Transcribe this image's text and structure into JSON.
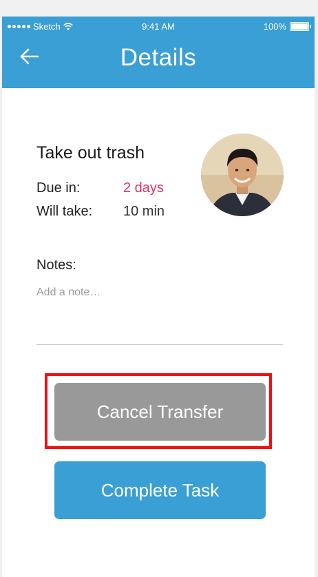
{
  "status_bar": {
    "carrier": "Sketch",
    "time": "9:41 AM",
    "battery": "100%"
  },
  "header": {
    "title": "Details",
    "back_icon": "arrow-left-icon"
  },
  "task": {
    "title": "Take out trash",
    "due_label": "Due in:",
    "due_value": "2 days",
    "duration_label": "Will take:",
    "duration_value": "10 min"
  },
  "notes": {
    "label": "Notes:",
    "placeholder": "Add a note…"
  },
  "actions": {
    "cancel_label": "Cancel Transfer",
    "complete_label": "Complete Task"
  },
  "colors": {
    "header": "#3a9fd4",
    "due_value": "#e0335f",
    "cancel_button": "#999999",
    "complete_button": "#3a9fd4",
    "highlight": "#ee1111"
  }
}
